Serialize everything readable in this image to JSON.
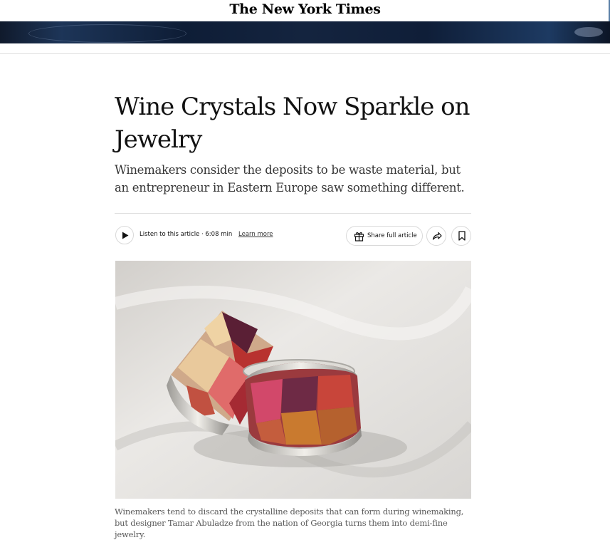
{
  "masthead": {
    "logo_text": "The New York Times"
  },
  "article": {
    "headline": "Wine Crystals Now Sparkle on Jewelry",
    "summary": "Winemakers consider the deposits to be waste material, but an entrepreneur in Eastern Europe saw something different.",
    "caption": "Winemakers tend to discard the crystalline deposits that can form during winemaking, but designer Tamar Abuladze from the nation of Georgia turns them into demi-fine jewelry."
  },
  "audio": {
    "listen_label": "Listen to this article · 6:08 min",
    "learn_more_label": "Learn more"
  },
  "toolbar": {
    "share_full_label": "Share full article"
  },
  "icons": {
    "play": "play-icon",
    "gift": "gift-icon",
    "share": "share-arrow-icon",
    "bookmark": "bookmark-icon"
  },
  "colors": {
    "text": "#121212",
    "summary_text": "#363636",
    "caption_text": "#5a5a5a",
    "divider": "#dfdfdf",
    "banner": "#14243f"
  }
}
